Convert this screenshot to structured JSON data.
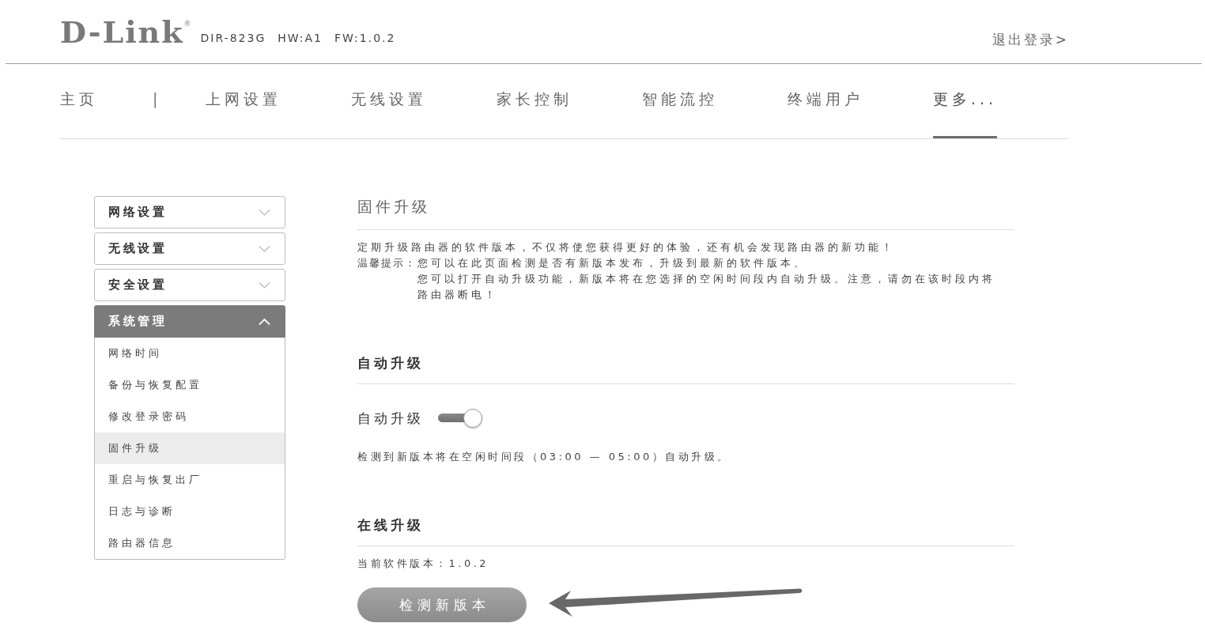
{
  "header": {
    "logo": "D-Link",
    "logo_mark": "®",
    "model_info": [
      "DIR-823G",
      "HW:A1",
      "FW:1.0.2"
    ],
    "logout": "退出登录>"
  },
  "nav": {
    "separator": "|",
    "items": [
      {
        "label": "主页",
        "selected": false
      },
      {
        "label": "上网设置",
        "selected": false
      },
      {
        "label": "无线设置",
        "selected": false
      },
      {
        "label": "家长控制",
        "selected": false
      },
      {
        "label": "智能流控",
        "selected": false
      },
      {
        "label": "终端用户",
        "selected": false
      },
      {
        "label": "更多...",
        "selected": true
      }
    ]
  },
  "sidebar": {
    "groups": [
      {
        "label": "网络设置",
        "expanded": false
      },
      {
        "label": "无线设置",
        "expanded": false
      },
      {
        "label": "安全设置",
        "expanded": false
      },
      {
        "label": "系统管理",
        "expanded": true,
        "children": [
          {
            "label": "网络时间",
            "selected": false
          },
          {
            "label": "备份与恢复配置",
            "selected": false
          },
          {
            "label": "修改登录密码",
            "selected": false
          },
          {
            "label": "固件升级",
            "selected": true
          },
          {
            "label": "重启与恢复出厂",
            "selected": false
          },
          {
            "label": "日志与诊断",
            "selected": false
          },
          {
            "label": "路由器信息",
            "selected": false
          }
        ]
      }
    ]
  },
  "page": {
    "title": "固件升级",
    "intro": "定期升级路由器的软件版本，不仅将使您获得更好的体验，还有机会发现路由器的新功能！",
    "tip_label": "温馨提示：",
    "tips": [
      "您可以在此页面检测是否有新版本发布，升级到最新的软件版本。",
      "您可以打开自动升级功能，新版本将在您选择的空闲时间段内自动升级。注意，请勿在该时段内将路由器断电！"
    ]
  },
  "auto_upgrade": {
    "heading": "自动升级",
    "toggle": {
      "label": "自动升级",
      "on": true
    },
    "note": "检测到新版本将在空闲时间段（03:00 — 05:00）自动升级。"
  },
  "online_upgrade": {
    "heading": "在线升级",
    "version": "当前软件版本：1.0.2",
    "button": "检测新版本"
  }
}
